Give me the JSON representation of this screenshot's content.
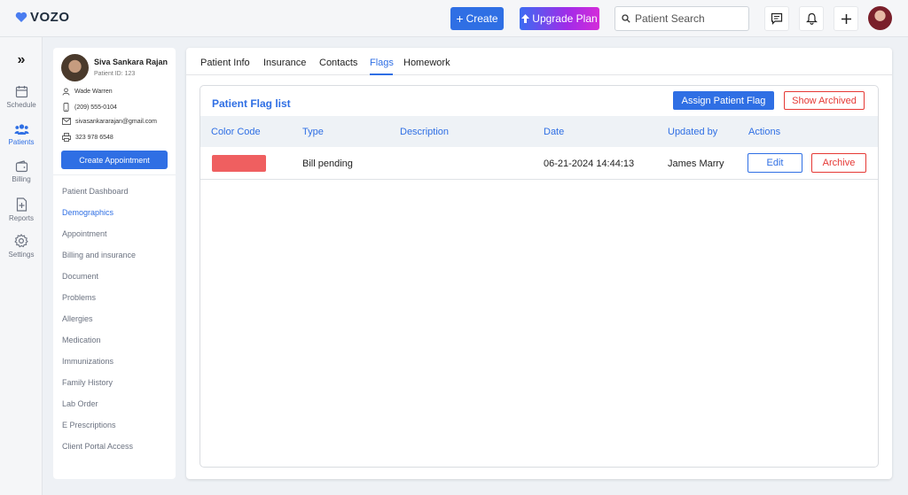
{
  "app": {
    "name": "VOZO",
    "brand_color": "#2f6fe4"
  },
  "header": {
    "create_label": "Create",
    "upgrade_label": "Upgrade Plan",
    "search_placeholder": "Patient Search",
    "icons": [
      "chat-icon",
      "bell-icon",
      "plus-icon"
    ]
  },
  "rail": {
    "items": [
      {
        "label": "Schedule",
        "icon": "calendar-icon"
      },
      {
        "label": "Patients",
        "icon": "users-icon",
        "active": true
      },
      {
        "label": "Billing",
        "icon": "wallet-icon"
      },
      {
        "label": "Reports",
        "icon": "report-icon"
      },
      {
        "label": "Settings",
        "icon": "gear-icon"
      }
    ]
  },
  "patient": {
    "name": "Siva Sankara Rajan",
    "id_text": "Patient ID: 123",
    "contact_name": "Wade Warren",
    "phone": "(209) 555-0104",
    "email": "sivasankararajan@gmail.com",
    "fax": "323 978 6548",
    "create_appointment_label": "Create Appointment"
  },
  "sidebar_nav": [
    "Patient Dashboard",
    "Demographics",
    "Appointment",
    "Billing and insurance",
    "Document",
    "Problems",
    "Allergies",
    "Medication",
    "Immunizations",
    "Family History",
    "Lab Order",
    "E Prescriptions",
    "Client Portal Access"
  ],
  "sidebar_active": "Demographics",
  "tabs": [
    "Patient Info",
    "Insurance",
    "Contacts",
    "Flags",
    "Homework"
  ],
  "active_tab": "Flags",
  "flag_list": {
    "title": "Patient Flag list",
    "assign_label": "Assign Patient Flag",
    "show_archived_label": "Show Archived",
    "columns": [
      "Color Code",
      "Type",
      "Description",
      "Date",
      "Updated by",
      "Actions"
    ],
    "rows": [
      {
        "color": "#ef5f60",
        "type": "Bill pending",
        "description": "",
        "date": "06-21-2024 14:44:13",
        "updated_by": "James Marry",
        "edit_label": "Edit",
        "archive_label": "Archive"
      }
    ]
  }
}
